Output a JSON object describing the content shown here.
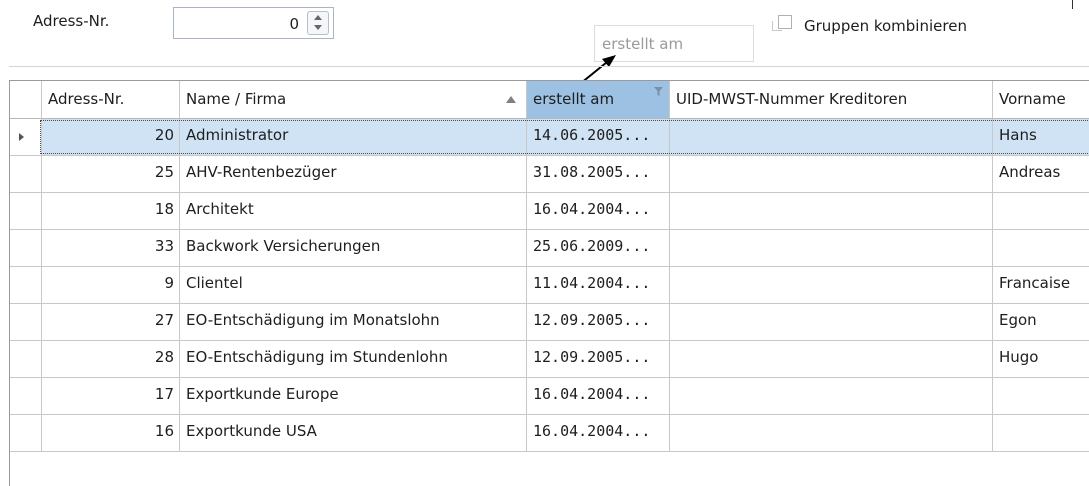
{
  "filter": {
    "adress_label": "Adress-Nr.",
    "adress_value": "0",
    "drop_placeholder": "erstellt am",
    "group_checkbox_label": "Gruppen kombinieren",
    "group_checked": false
  },
  "grid": {
    "columns": [
      {
        "label": ""
      },
      {
        "label": "Adress-Nr."
      },
      {
        "label": "Name / Firma",
        "sort": "ascending"
      },
      {
        "label": "erstellt am",
        "filtered": true
      },
      {
        "label": "UID-MWST-Nummer Kreditoren"
      },
      {
        "label": "Vorname"
      }
    ],
    "selected_row": 0,
    "rows": [
      {
        "nr": "20",
        "name": "Administrator",
        "date": "14.06.2005...",
        "uid": "",
        "vorname": "Hans"
      },
      {
        "nr": "25",
        "name": "AHV-Rentenbezüger",
        "date": "31.08.2005...",
        "uid": "",
        "vorname": "Andreas"
      },
      {
        "nr": "18",
        "name": "Architekt",
        "date": "16.04.2004...",
        "uid": "",
        "vorname": ""
      },
      {
        "nr": "33",
        "name": "Backwork Versicherungen",
        "date": "25.06.2009...",
        "uid": "",
        "vorname": ""
      },
      {
        "nr": "9",
        "name": "Clientel",
        "date": "11.04.2004...",
        "uid": "",
        "vorname": "Francaise"
      },
      {
        "nr": "27",
        "name": "EO-Entschädigung im Monatslohn",
        "date": "12.09.2005...",
        "uid": "",
        "vorname": "Egon"
      },
      {
        "nr": "28",
        "name": "EO-Entschädigung im Stundenlohn",
        "date": "12.09.2005...",
        "uid": "",
        "vorname": "Hugo"
      },
      {
        "nr": "17",
        "name": "Exportkunde Europe",
        "date": "16.04.2004...",
        "uid": "",
        "vorname": ""
      },
      {
        "nr": "16",
        "name": "Exportkunde USA",
        "date": "16.04.2004...",
        "uid": "",
        "vorname": ""
      }
    ]
  },
  "colors": {
    "active_header": "#9cc1e3",
    "selected_row": "#cfe3f5"
  }
}
